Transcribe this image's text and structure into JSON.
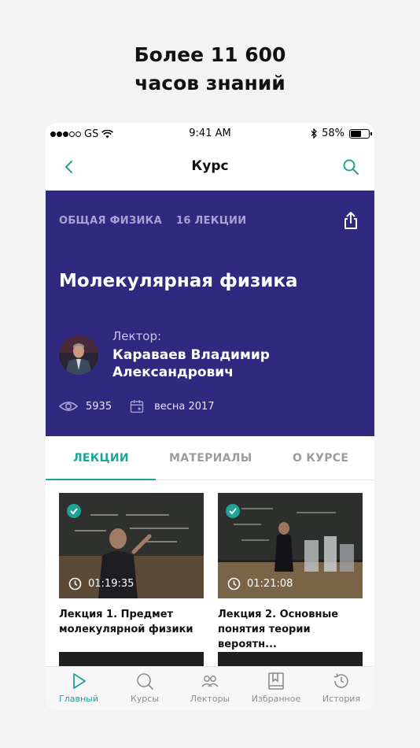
{
  "headline": {
    "line1": "Более 11 600",
    "line2": "часов знаний"
  },
  "status_bar": {
    "carrier": "GS",
    "time": "9:41 AM",
    "battery": "58%"
  },
  "nav": {
    "title": "Курс",
    "back_icon": "chevron-left-icon",
    "search_icon": "search-icon"
  },
  "course": {
    "category": "ОБЩАЯ ФИЗИКА",
    "lectures_count": "16 ЛЕКЦИИ",
    "title": "Молекулярная физика",
    "lecturer_caption": "Лектор:",
    "lecturer_name": "Караваев Владимир Александрович",
    "views": "5935",
    "semester": "весна 2017"
  },
  "tabs": [
    {
      "label": "ЛЕКЦИИ",
      "active": true
    },
    {
      "label": "МАТЕРИАЛЫ",
      "active": false
    },
    {
      "label": "О КУРСЕ",
      "active": false
    }
  ],
  "lectures": [
    {
      "duration": "01:19:35",
      "title": "Лекция 1. Предмет молекулярной физики",
      "watched": true
    },
    {
      "duration": "01:21:08",
      "title": "Лекция 2. Основные понятия теории вероятн...",
      "watched": true
    }
  ],
  "tab_bar": [
    {
      "label": "Главный",
      "icon": "play-icon",
      "active": true
    },
    {
      "label": "Курсы",
      "icon": "search-icon",
      "active": false
    },
    {
      "label": "Лекторы",
      "icon": "people-icon",
      "active": false
    },
    {
      "label": "Избранное",
      "icon": "bookmark-icon",
      "active": false
    },
    {
      "label": "История",
      "icon": "history-icon",
      "active": false
    }
  ],
  "colors": {
    "accent": "#1ea397",
    "hero_bg": "#31297f"
  }
}
